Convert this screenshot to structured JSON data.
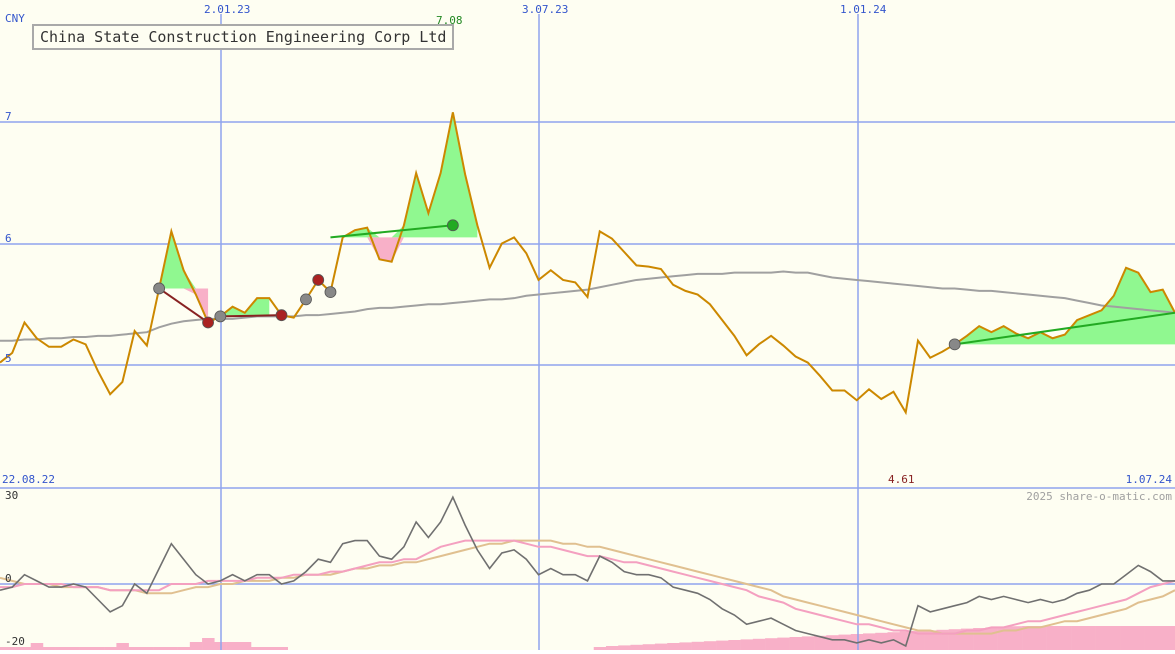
{
  "title": "China State Construction Engineering Corp Ltd",
  "currency": "CNY",
  "date_labels": [
    "2.01.23",
    "3.07.23",
    "1.01.24"
  ],
  "start_date": "22.08.22",
  "end_date": "1.07.24",
  "max_label": "7.08",
  "min_label": "4.61",
  "price_ticks": [
    "7",
    "6",
    "5"
  ],
  "osc_ticks": [
    "30",
    "0",
    "-20"
  ],
  "watermark": "2025 share-o-matic.com",
  "colors": {
    "price": "#cc8800",
    "ma": "#a0a0a0",
    "grid": "#8fa4ee",
    "label_blue": "#3355cc",
    "up_fill": "#90f890",
    "down_fill": "#f8b0c8",
    "trend_up": "#22aa22",
    "trend_down": "#882222",
    "osc_dark": "#707070",
    "osc_pink": "#f4a0c0",
    "osc_tan": "#e0c090",
    "volume": "#f8b0c8"
  },
  "chart_data": [
    {
      "type": "line",
      "title": "China State Construction Engineering Corp Ltd",
      "ylabel": "CNY",
      "x_start": "22.08.22",
      "x_end": "1.07.24",
      "ylim": [
        4.0,
        7.9
      ],
      "high": 7.08,
      "low": 4.61,
      "series": [
        {
          "values": [
            5.02,
            5.1,
            5.35,
            5.22,
            5.15,
            5.15,
            5.21,
            5.17,
            4.95,
            4.76,
            4.86,
            5.28,
            5.16,
            5.63,
            6.1,
            5.78,
            5.58,
            5.35,
            5.4,
            5.48,
            5.43,
            5.55,
            5.55,
            5.41,
            5.39,
            5.54,
            5.7,
            5.6,
            6.05,
            6.11,
            6.13,
            5.87,
            5.85,
            6.15,
            6.58,
            6.25,
            6.58,
            7.08,
            6.57,
            6.15,
            5.8,
            6.0,
            6.05,
            5.92,
            5.7,
            5.78,
            5.7,
            5.68,
            5.56,
            6.1,
            6.04,
            5.93,
            5.82,
            5.81,
            5.79,
            5.66,
            5.61,
            5.58,
            5.5,
            5.37,
            5.24,
            5.08,
            5.17,
            5.24,
            5.16,
            5.07,
            5.02,
            4.91,
            4.79,
            4.79,
            4.71,
            4.8,
            4.72,
            4.78,
            4.61,
            5.2,
            5.06,
            5.11,
            5.17,
            5.24,
            5.32,
            5.27,
            5.32,
            5.26,
            5.22,
            5.27,
            5.22,
            5.25,
            5.37,
            5.41,
            5.45,
            5.57,
            5.8,
            5.76,
            5.6,
            5.62,
            5.43
          ]
        },
        {
          "values": [
            5.2,
            5.2,
            5.21,
            5.21,
            5.22,
            5.22,
            5.23,
            5.23,
            5.24,
            5.24,
            5.25,
            5.26,
            5.27,
            5.31,
            5.34,
            5.36,
            5.37,
            5.38,
            5.38,
            5.38,
            5.39,
            5.4,
            5.4,
            5.4,
            5.4,
            5.41,
            5.41,
            5.42,
            5.43,
            5.44,
            5.46,
            5.47,
            5.47,
            5.48,
            5.49,
            5.5,
            5.5,
            5.51,
            5.52,
            5.53,
            5.54,
            5.54,
            5.55,
            5.57,
            5.58,
            5.59,
            5.6,
            5.61,
            5.62,
            5.64,
            5.66,
            5.68,
            5.7,
            5.71,
            5.72,
            5.73,
            5.74,
            5.75,
            5.75,
            5.75,
            5.76,
            5.76,
            5.76,
            5.76,
            5.77,
            5.76,
            5.76,
            5.74,
            5.72,
            5.71,
            5.7,
            5.69,
            5.68,
            5.67,
            5.66,
            5.65,
            5.64,
            5.63,
            5.63,
            5.62,
            5.61,
            5.61,
            5.6,
            5.59,
            5.58,
            5.57,
            5.56,
            5.55,
            5.53,
            5.51,
            5.49,
            5.48,
            5.47,
            5.46,
            5.45,
            5.44,
            5.43
          ]
        }
      ]
    },
    {
      "type": "line",
      "ylim": [
        -20,
        30
      ],
      "series": [
        {
          "values": [
            -2,
            -1,
            3,
            1,
            -1,
            -1,
            0,
            -1,
            -5,
            -9,
            -7,
            0,
            -3,
            5,
            13,
            8,
            3,
            0,
            1,
            3,
            1,
            3,
            3,
            0,
            1,
            4,
            8,
            7,
            13,
            14,
            14,
            9,
            8,
            12,
            20,
            15,
            20,
            28,
            19,
            11,
            5,
            10,
            11,
            8,
            3,
            5,
            3,
            3,
            1,
            9,
            7,
            4,
            3,
            3,
            2,
            -1,
            -2,
            -3,
            -5,
            -8,
            -10,
            -13,
            -12,
            -11,
            -13,
            -15,
            -16,
            -17,
            -18,
            -18,
            -19,
            -18,
            -19,
            -18,
            -20,
            -7,
            -9,
            -8,
            -7,
            -6,
            -4,
            -5,
            -4,
            -5,
            -6,
            -5,
            -6,
            -5,
            -3,
            -2,
            0,
            0,
            3,
            6,
            4,
            1,
            1
          ]
        },
        {
          "values": [
            -1,
            -1,
            0,
            0,
            0,
            0,
            -1,
            -1,
            -1,
            -2,
            -2,
            -2,
            -2,
            -2,
            0,
            0,
            0,
            1,
            1,
            1,
            1,
            2,
            2,
            2,
            3,
            3,
            3,
            4,
            4,
            5,
            6,
            7,
            7,
            8,
            8,
            10,
            12,
            13,
            14,
            14,
            14,
            14,
            14,
            13,
            12,
            12,
            11,
            10,
            9,
            9,
            8,
            7,
            7,
            6,
            5,
            4,
            3,
            2,
            1,
            0,
            -1,
            -2,
            -4,
            -5,
            -6,
            -8,
            -9,
            -10,
            -11,
            -12,
            -13,
            -13,
            -14,
            -15,
            -15,
            -16,
            -16,
            -16,
            -16,
            -15,
            -15,
            -14,
            -14,
            -13,
            -12,
            -12,
            -11,
            -10,
            -9,
            -8,
            -7,
            -6,
            -5,
            -3,
            -1,
            0,
            1
          ]
        },
        {
          "values": [
            2,
            1,
            0,
            0,
            0,
            -1,
            -1,
            -1,
            -1,
            -2,
            -2,
            -2,
            -3,
            -3,
            -3,
            -2,
            -1,
            -1,
            0,
            0,
            1,
            1,
            1,
            2,
            2,
            3,
            3,
            3,
            4,
            5,
            5,
            6,
            6,
            7,
            7,
            8,
            9,
            10,
            11,
            12,
            13,
            13,
            14,
            14,
            14,
            14,
            13,
            13,
            12,
            12,
            11,
            10,
            9,
            8,
            7,
            6,
            5,
            4,
            3,
            2,
            1,
            0,
            -1,
            -2,
            -4,
            -5,
            -6,
            -7,
            -8,
            -9,
            -10,
            -11,
            -12,
            -13,
            -14,
            -15,
            -15,
            -16,
            -16,
            -16,
            -16,
            -16,
            -15,
            -15,
            -14,
            -14,
            -13,
            -12,
            -12,
            -11,
            -10,
            -9,
            -8,
            -6,
            -5,
            -4,
            -2
          ]
        }
      ]
    }
  ]
}
